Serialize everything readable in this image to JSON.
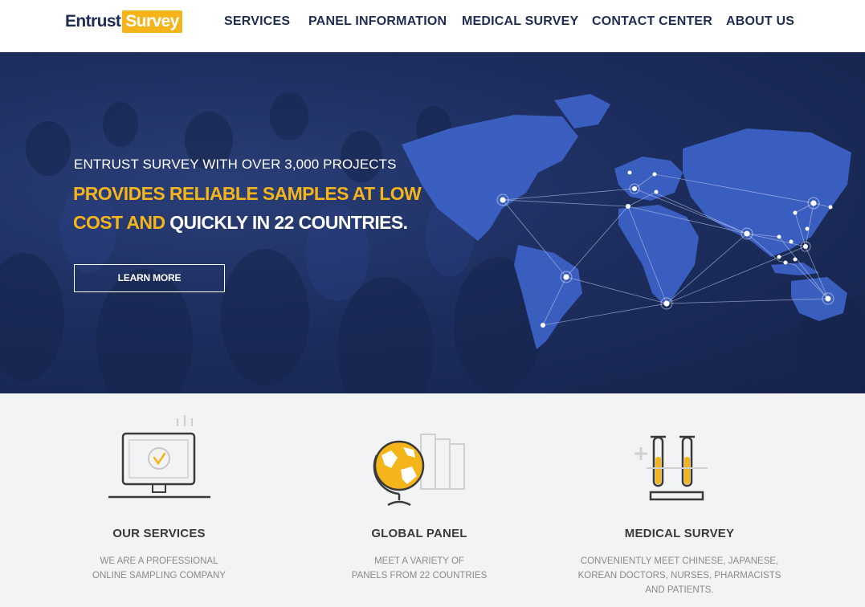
{
  "header": {
    "logo_part1": "Entrust",
    "logo_part2": "Survey",
    "nav": [
      "SERVICES",
      "PANEL INFORMATION",
      "MEDICAL SURVEY",
      "CONTACT CENTER",
      "ABOUT US"
    ]
  },
  "hero": {
    "subtitle": "ENTRUST SURVEY WITH OVER 3,000 PROJECTS",
    "headline_line1": "PROVIDES RELIABLE SAMPLES AT LOW",
    "headline_line2_yellow": "COST AND",
    "headline_line2_white": "QUICKLY IN 22 COUNTRIES.",
    "button_label": "LEARN MORE"
  },
  "features": [
    {
      "title": "OUR SERVICES",
      "desc_lines": [
        "WE ARE A PROFESSIONAL",
        "ONLINE SAMPLING COMPANY"
      ],
      "icon": "monitor-check-icon"
    },
    {
      "title": "GLOBAL PANEL",
      "desc_lines": [
        "MEET A VARIETY OF",
        "PANELS FROM 22 COUNTRIES"
      ],
      "icon": "globe-icon"
    },
    {
      "title": "MEDICAL SURVEY",
      "desc_lines": [
        "CONVENIENTLY MEET CHINESE, JAPANESE,",
        "KOREAN DOCTORS, NURSES, PHARMACISTS",
        "AND PATIENTS."
      ],
      "icon": "test-tubes-icon"
    }
  ],
  "colors": {
    "brand_navy": "#1f2d52",
    "accent_yellow": "#f5b41a",
    "hero_bg": "#1d2e5f",
    "map_blue": "#3d63c8"
  }
}
